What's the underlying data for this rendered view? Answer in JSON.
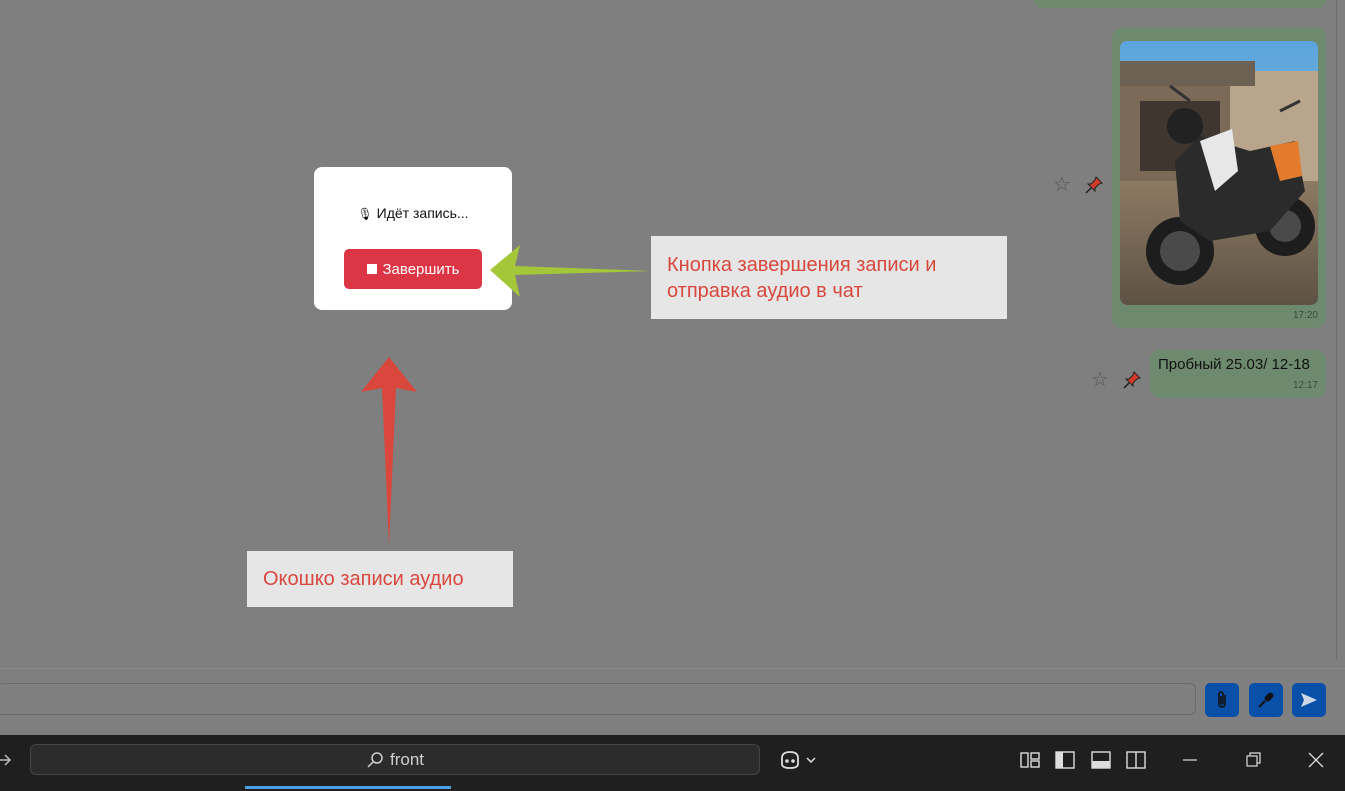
{
  "chat": {
    "photo_message": {
      "time": "17:20"
    },
    "text_message": {
      "text": "Пробный 25.03/ 12-18",
      "time": "12:17"
    }
  },
  "recorder": {
    "mic_glyph": "🎙",
    "status": "Идёт запись...",
    "finish_label": "Завершить"
  },
  "annotations": {
    "finish_note": "Кнопка завершения записи и отправка аудио в чат",
    "window_note": "Окошко записи аудио"
  },
  "composer": {
    "attach_icon": "paperclip-icon",
    "mic_icon": "microphone-icon",
    "send_icon": "send-icon",
    "accent_color": "#0a4fa8"
  },
  "taskbar": {
    "search_text": "front",
    "colors": {
      "active_tab": "#4aa0e6",
      "record_button": "#dc3545",
      "callout_text": "#d9473d"
    }
  }
}
